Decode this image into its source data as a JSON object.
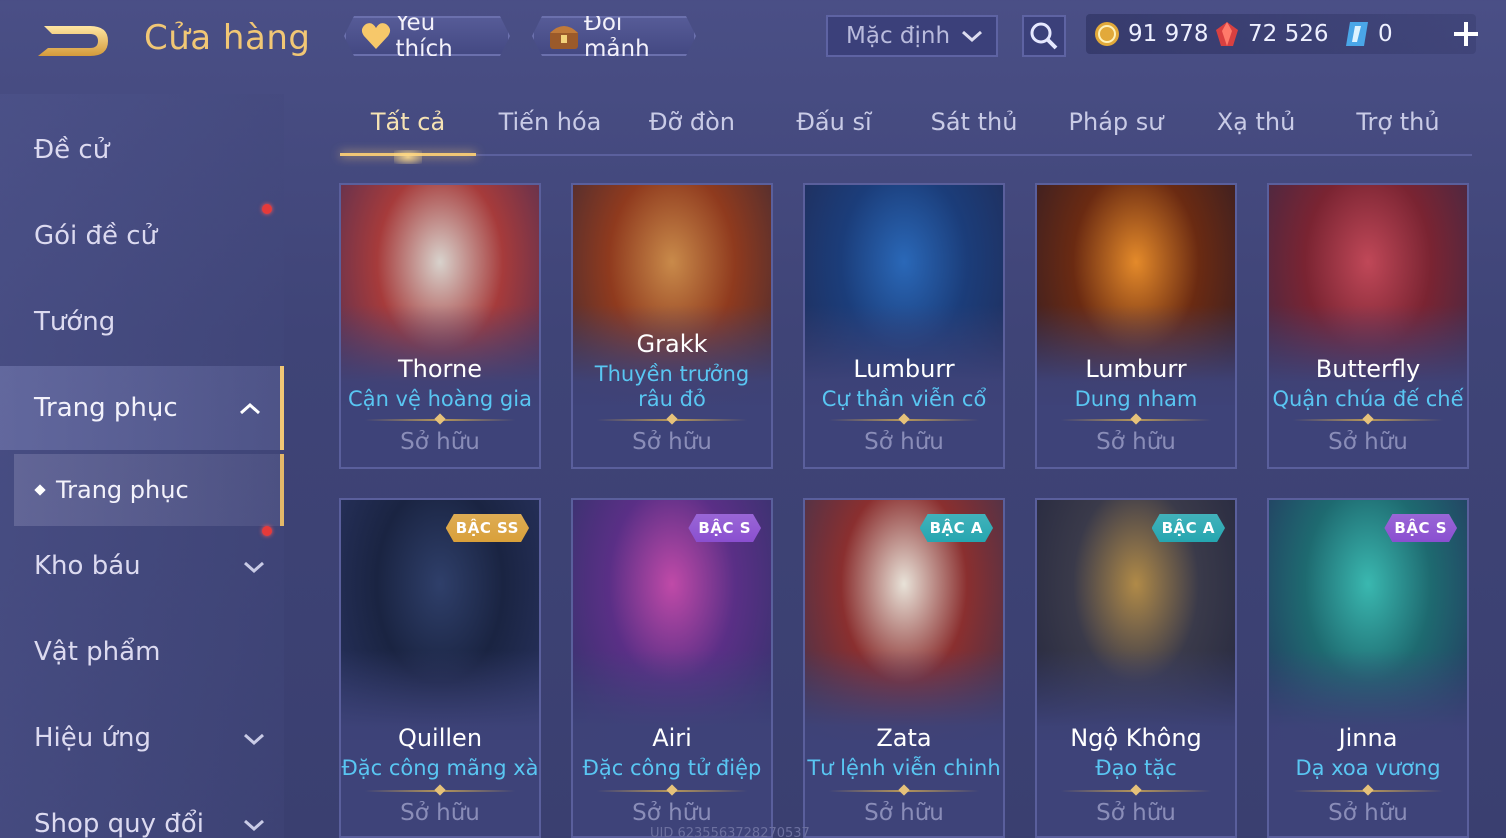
{
  "header": {
    "title": "Cửa hàng",
    "favorite_label": "Yêu thích",
    "exchange_label": "Đổi mảnh",
    "sort_value": "Mặc định",
    "currency": {
      "gold": "91 978",
      "ruby": "72 526",
      "voucher": "0"
    }
  },
  "sidebar": {
    "items": [
      {
        "label": "Đề cử"
      },
      {
        "label": "Gói đề cử"
      },
      {
        "label": "Tướng"
      },
      {
        "label": "Trang phục"
      },
      {
        "label": "Kho báu"
      },
      {
        "label": "Vật phẩm"
      },
      {
        "label": "Hiệu ứng"
      },
      {
        "label": "Shop quy đổi"
      }
    ],
    "sub_item": "Trang phục"
  },
  "tabs": [
    {
      "label": "Tất cả"
    },
    {
      "label": "Tiến hóa"
    },
    {
      "label": "Đỡ đòn"
    },
    {
      "label": "Đấu sĩ"
    },
    {
      "label": "Sát thủ"
    },
    {
      "label": "Pháp sư"
    },
    {
      "label": "Xạ thủ"
    },
    {
      "label": "Trợ thủ"
    }
  ],
  "cards": [
    {
      "hero": "Thorne",
      "skin": "Cận vệ hoàng gia",
      "status": "Sở hữu",
      "badge": "",
      "colors": [
        "#d8d2cc",
        "#a63b3b",
        "#4a2e55"
      ]
    },
    {
      "hero": "Grakk",
      "skin": "Thuyền trưởng râu đỏ",
      "status": "Sở hữu",
      "badge": "",
      "colors": [
        "#c98a4a",
        "#8f3a1e",
        "#3c2a36"
      ]
    },
    {
      "hero": "Lumburr",
      "skin": "Cự thần viễn cổ",
      "status": "Sở hữu",
      "badge": "",
      "colors": [
        "#2a68b8",
        "#1b3d7a",
        "#222b55"
      ]
    },
    {
      "hero": "Lumburr",
      "skin": "Dung nham",
      "status": "Sở hữu",
      "badge": "",
      "colors": [
        "#e48a2a",
        "#6a2a12",
        "#2c1c28"
      ]
    },
    {
      "hero": "Butterfly",
      "skin": "Quận chúa đế chế",
      "status": "Sở hữu",
      "badge": "",
      "colors": [
        "#c04858",
        "#7a2432",
        "#3a2a48"
      ]
    },
    {
      "hero": "Quillen",
      "skin": "Đặc công mãng xà",
      "status": "Sở hữu",
      "badge": "BẬC SS",
      "badge_color": "#d9a03a",
      "colors": [
        "#2f3f6a",
        "#1a2442",
        "#2a3462"
      ]
    },
    {
      "hero": "Airi",
      "skin": "Đặc công tử điệp",
      "status": "Sở hữu",
      "badge": "BẬC S",
      "badge_color": "#8a4fd0",
      "colors": [
        "#c04aa8",
        "#5a2f86",
        "#2f3468"
      ]
    },
    {
      "hero": "Zata",
      "skin": "Tư lệnh viễn chinh",
      "status": "Sở hữu",
      "badge": "BẬC A",
      "badge_color": "#25a6b0",
      "colors": [
        "#e8e2d8",
        "#8a2f2f",
        "#3a3452"
      ]
    },
    {
      "hero": "Ngộ Không",
      "skin": "Đạo tặc",
      "status": "Sở hữu",
      "badge": "BẬC A",
      "badge_color": "#25a6b0",
      "colors": [
        "#b08a48",
        "#3a3a4a",
        "#23263e"
      ]
    },
    {
      "hero": "Jinna",
      "skin": "Dạ xoa vương",
      "status": "Sở hữu",
      "badge": "BẬC S",
      "badge_color": "#8a4fd0",
      "colors": [
        "#3ab8b0",
        "#1e6a70",
        "#25335e"
      ]
    }
  ],
  "footer": {
    "uid": "UID 6235563728270537"
  }
}
